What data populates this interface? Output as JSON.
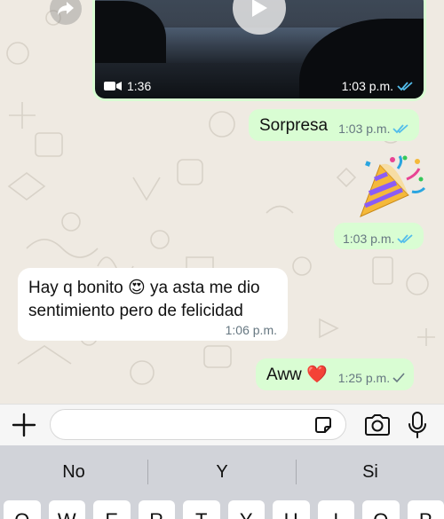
{
  "chat": {
    "video": {
      "duration": "1:36",
      "time": "1:03 p.m.",
      "status_icon": "double-check-read-icon"
    },
    "messages": [
      {
        "direction": "out",
        "text": "Sorpresa",
        "time": "1:03 p.m.",
        "status": "read"
      },
      {
        "direction": "out",
        "sticker": "party-popper",
        "time": "1:03 p.m.",
        "status": "read"
      },
      {
        "direction": "in",
        "line1": "Hay q bonito 😍 ya asta me dio",
        "line2": "sentimiento pero de felicidad",
        "time": "1:06 p.m."
      },
      {
        "direction": "out",
        "text": "Aww ❤️",
        "time": "1:25 p.m.",
        "status": "sent"
      }
    ]
  },
  "input": {
    "value": "",
    "placeholder": ""
  },
  "keyboard": {
    "suggestions": [
      "No",
      "Y",
      "Si"
    ],
    "top_row": [
      "Q",
      "W",
      "E",
      "R",
      "T",
      "Y",
      "U",
      "I",
      "O",
      "P"
    ]
  },
  "colors": {
    "chat_bg": "#efeae2",
    "outgoing_bubble": "#d9fdd3",
    "incoming_bubble": "#ffffff",
    "read_tick": "#53bdeb",
    "keyboard_bg": "#d1d3d9"
  }
}
